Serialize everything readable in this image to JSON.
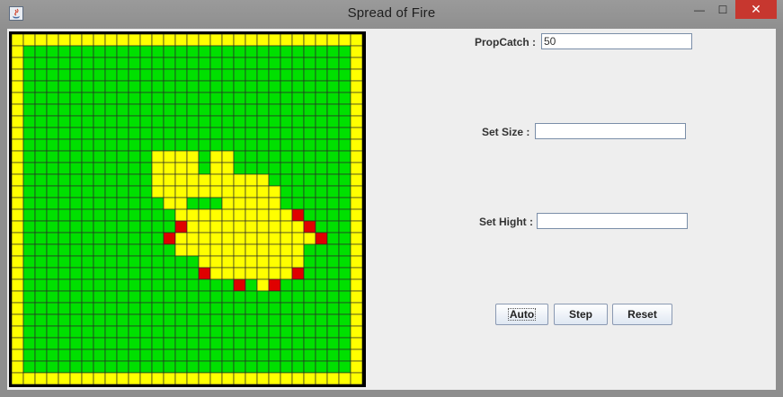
{
  "window": {
    "title": "Spread of Fire",
    "controls": {
      "minimize": "—",
      "maximize": "☐",
      "close": "✕"
    }
  },
  "form": {
    "prop_catch": {
      "label": "PropCatch :",
      "value": "50"
    },
    "set_size": {
      "label": "Set Size :",
      "value": ""
    },
    "set_height": {
      "label": "Set Hight :",
      "value": ""
    }
  },
  "buttons": {
    "auto": "Auto",
    "step": "Step",
    "reset": "Reset"
  },
  "colors": {
    "tree": "#00e000",
    "empty": "#ffff00",
    "burning": "#e00000",
    "gridline": "#2a2a2a"
  },
  "grid": {
    "cols": 30,
    "rows": 30,
    "legend": "T = tree (green), E = empty (yellow), B = burning (red)",
    "cells": [
      "EEEEEEEEEEEEEEEEEEEEEEEEEEEEEE",
      "ETTTTTTTTTTTTTTTTTTTTTTTTTTTTE",
      "ETTTTTTTTTTTTTTTTTTTTTTTTTTTTE",
      "ETTTTTTTTTTTTTTTTTTTTTTTTTTTTE",
      "ETTTTTTTTTTTTTTTTTTTTTTTTTTTTE",
      "ETTTTTTTTTTTTTTTTTTTTTTTTTTTTE",
      "ETTTTTTTTTTTTTTTTTTTTTTTTTTTTE",
      "ETTTTTTTTTTTTTTTTTTTTTTTTTTTTE",
      "ETTTTTTTTTTTTTTTTTTTTTTTTTTTTE",
      "ETTTTTTTTTTTTTTTTTTTTTTTTTTTTE",
      "ETTTTTTTTTTTEEEETEETTTTTTTTTTE",
      "ETTTTTTTTTTTEEEETEETTTTTTTTTTE",
      "ETTTTTTTTTTTEEEEEEEEEETTTTTTTE",
      "ETTTTTTTTTTTEEEEEEEEEEETTTTTTE",
      "ETTTTTTTTTTTTEETTTEEEEETTTTTTE",
      "ETTTTTTTTTTTTTEEEEEEEEEEBTTTTE",
      "ETTTTTTTTTTTTTBEEEEEEEEEEBTTTE",
      "ETTTTTTTTTTTTBEEEEEEEEEEEEBTTE",
      "ETTTTTTTTTTTTTEEEEEEEEEEETTTTE",
      "ETTTTTTTTTTTTTTTEEEEEEEEETTTTE",
      "ETTTTTTTTTTTTTTTBEEEEEEEBTTTTE",
      "ETTTTTTTTTTTTTTTTTTBTEBTTTTTTE",
      "ETTTTTTTTTTTTTTTTTTTTTTTTTTTTE",
      "ETTTTTTTTTTTTTTTTTTTTTTTTTTTTE",
      "ETTTTTTTTTTTTTTTTTTTTTTTTTTTTE",
      "ETTTTTTTTTTTTTTTTTTTTTTTTTTTTE",
      "ETTTTTTTTTTTTTTTTTTTTTTTTTTTTE",
      "ETTTTTTTTTTTTTTTTTTTTTTTTTTTTE",
      "ETTTTTTTTTTTTTTTTTTTTTTTTTTTTE",
      "EEEEEEEEEEEEEEEEEEEEEEEEEEEEEE"
    ]
  }
}
